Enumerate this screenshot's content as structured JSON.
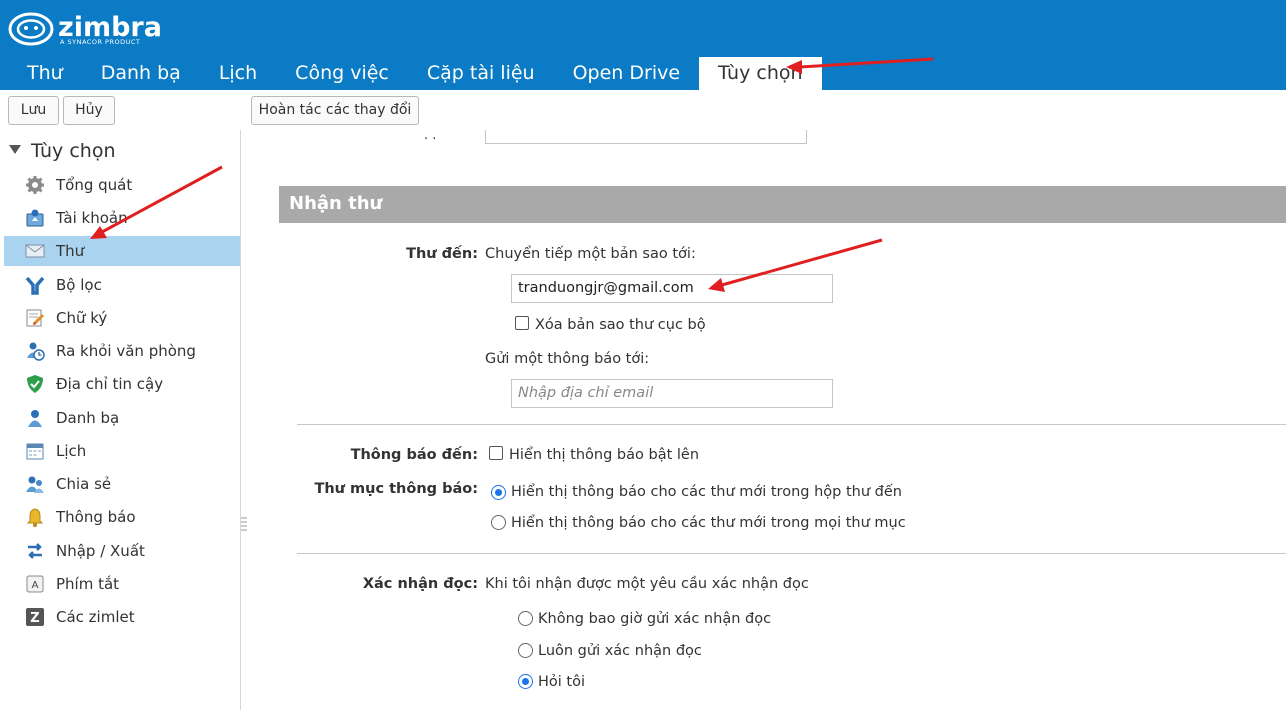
{
  "brand": {
    "name": "zimbra",
    "subtitle": "A SYNACOR PRODUCT"
  },
  "nav": {
    "tabs": [
      {
        "label": "Thư"
      },
      {
        "label": "Danh bạ"
      },
      {
        "label": "Lịch"
      },
      {
        "label": "Công việc"
      },
      {
        "label": "Cặp tài liệu"
      },
      {
        "label": "Open Drive"
      },
      {
        "label": "Tùy chọn",
        "active": true
      }
    ]
  },
  "toolbar": {
    "save_label": "Lưu",
    "cancel_label": "Hủy",
    "revert_label": "Hoàn tác các thay đổi"
  },
  "sidebar": {
    "heading": "Tùy chọn",
    "items": [
      {
        "label": "Tổng quát",
        "icon": "gear-icon"
      },
      {
        "label": "Tài khoản",
        "icon": "account-icon"
      },
      {
        "label": "Thư",
        "icon": "mail-icon",
        "selected": true
      },
      {
        "label": "Bộ lọc",
        "icon": "filter-icon"
      },
      {
        "label": "Chữ ký",
        "icon": "signature-icon"
      },
      {
        "label": "Ra khỏi văn phòng",
        "icon": "out-of-office-icon"
      },
      {
        "label": "Địa chỉ tin cậy",
        "icon": "trusted-shield-icon"
      },
      {
        "label": "Danh bạ",
        "icon": "contact-icon"
      },
      {
        "label": "Lịch",
        "icon": "calendar-icon"
      },
      {
        "label": "Chia sẻ",
        "icon": "share-icon"
      },
      {
        "label": "Thông báo",
        "icon": "bell-icon"
      },
      {
        "label": "Nhập / Xuất",
        "icon": "import-export-icon"
      },
      {
        "label": "Phím tắt",
        "icon": "keyboard-shortcut-icon"
      },
      {
        "label": "Các zimlet",
        "icon": "zimlet-icon"
      }
    ]
  },
  "main": {
    "section_title": "Nhận thư",
    "incoming": {
      "label": "Thư đến:",
      "forward_label": "Chuyển tiếp một bản sao tới:",
      "forward_value": "tranduongjr@gmail.com",
      "delete_local_label": "Xóa bản sao thư cục bộ",
      "delete_local_checked": false,
      "notify_label": "Gửi một thông báo tới:",
      "notify_placeholder": "Nhập địa chỉ email"
    },
    "notification": {
      "label": "Thông báo đến:",
      "popup_label": "Hiển thị thông báo bật lên",
      "popup_checked": false
    },
    "notify_folder": {
      "label": "Thư mục thông báo:",
      "options": [
        {
          "label": "Hiển thị thông báo cho các thư mới trong hộp thư đến",
          "selected": true
        },
        {
          "label": "Hiển thị thông báo cho các thư mới trong mọi thư mục",
          "selected": false
        }
      ]
    },
    "read_receipt": {
      "label": "Xác nhận đọc:",
      "intro": "Khi tôi nhận được một yêu cầu xác nhận đọc",
      "options": [
        {
          "label": "Không bao giờ gửi xác nhận đọc",
          "selected": false
        },
        {
          "label": "Luôn gửi xác nhận đọc",
          "selected": false
        },
        {
          "label": "Hỏi tôi",
          "selected": true
        }
      ]
    }
  },
  "colors": {
    "brand_blue": "#0a7bc4",
    "selected_bg": "#a9d3ef",
    "section_bar": "#a9a9a9",
    "annotation_arrow": "#e02020"
  }
}
